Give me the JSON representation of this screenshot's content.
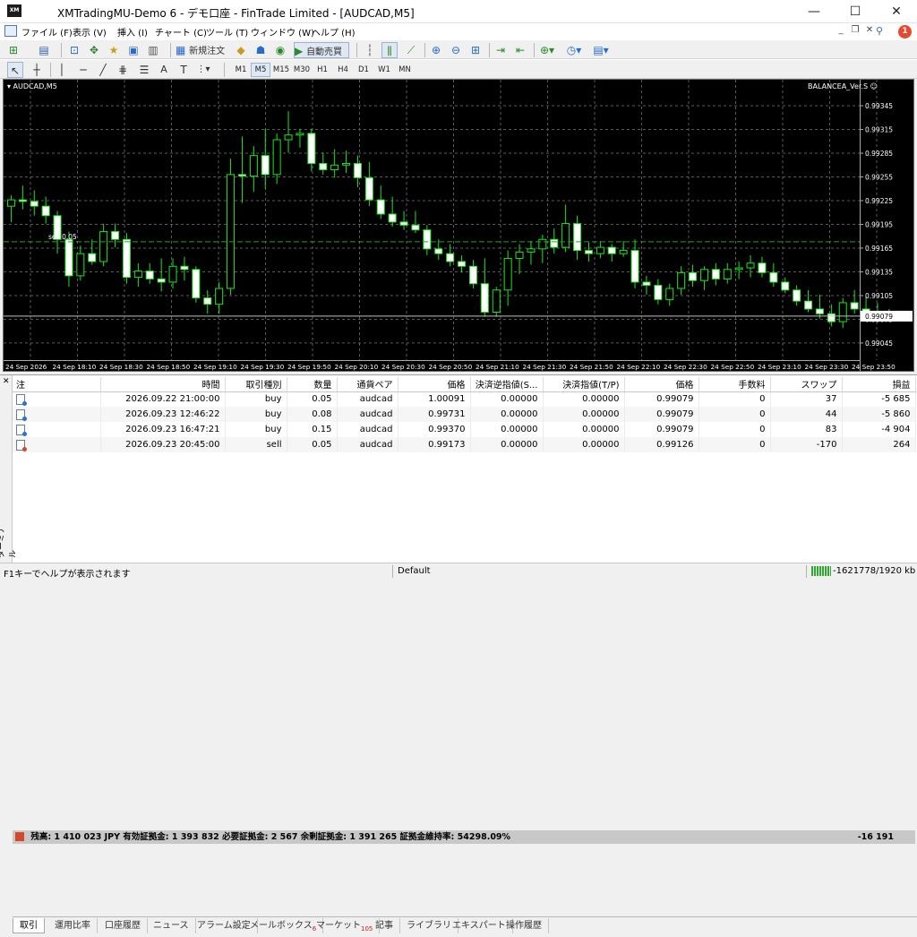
{
  "window": {
    "title": "XMTradingMU-Demo 6 - デモ口座 - FinTrade Limited - [AUDCAD,M5]",
    "minimize": "—",
    "maximize": "☐",
    "close": "✕"
  },
  "menu": {
    "items": [
      "ファイル (F)",
      "表示 (V)",
      "挿入 (I)",
      "チャート (C)",
      "ツール (T)",
      "ウィンドウ (W)",
      "ヘルプ (H)"
    ],
    "help_badge": "1"
  },
  "toolbar": {
    "new_order": "新規注文",
    "auto_trading": "自動売買"
  },
  "timeframes": [
    "M1",
    "M5",
    "M15",
    "M30",
    "H1",
    "H4",
    "D1",
    "W1",
    "MN"
  ],
  "active_timeframe": "M5",
  "chart": {
    "symbol_label": "▾ AUDCAD,M5",
    "ea_label": "BALANCEA_Ver.S ☺",
    "order_line_label": "sell 0.05",
    "current_price_label": "0.99079",
    "price_ticks": [
      "0.99345",
      "0.99315",
      "0.99285",
      "0.99255",
      "0.99225",
      "0.99195",
      "0.99165",
      "0.99135",
      "0.99105",
      "0.99075",
      "0.99045"
    ],
    "time_ticks": [
      "24 Sep 2026",
      "24 Sep 18:10",
      "24 Sep 18:30",
      "24 Sep 18:50",
      "24 Sep 19:10",
      "24 Sep 19:30",
      "24 Sep 19:50",
      "24 Sep 20:10",
      "24 Sep 20:30",
      "24 Sep 20:50",
      "24 Sep 21:10",
      "24 Sep 21:30",
      "24 Sep 21:50",
      "24 Sep 22:10",
      "24 Sep 22:30",
      "24 Sep 22:50",
      "24 Sep 23:10",
      "24 Sep 23:30",
      "24 Sep 23:50"
    ],
    "colors": {
      "background": "#000000",
      "grid": "#5a5a5a",
      "candle_bull_body": "#000000",
      "candle_bear_body": "#ffffff",
      "wick": "#19e619",
      "order_line": "#1fa51f",
      "bid_line": "#c0c0c0"
    },
    "price_range": [
      0.99037,
      0.99362
    ],
    "candles": [
      [
        0.99218,
        0.99232,
        0.99198,
        0.99226
      ],
      [
        0.99226,
        0.99244,
        0.99214,
        0.99224
      ],
      [
        0.99224,
        0.99238,
        0.99206,
        0.99218
      ],
      [
        0.99218,
        0.9923,
        0.99196,
        0.99206
      ],
      [
        0.99206,
        0.99212,
        0.99158,
        0.99176
      ],
      [
        0.99176,
        0.99186,
        0.99116,
        0.9913
      ],
      [
        0.9913,
        0.99168,
        0.99124,
        0.99158
      ],
      [
        0.99158,
        0.99176,
        0.99144,
        0.99148
      ],
      [
        0.99148,
        0.99196,
        0.99142,
        0.99186
      ],
      [
        0.99186,
        0.99196,
        0.99166,
        0.99176
      ],
      [
        0.99176,
        0.99184,
        0.9912,
        0.99128
      ],
      [
        0.99128,
        0.99146,
        0.99116,
        0.99136
      ],
      [
        0.99136,
        0.99146,
        0.9912,
        0.99126
      ],
      [
        0.99126,
        0.99152,
        0.9911,
        0.99122
      ],
      [
        0.99122,
        0.99152,
        0.99114,
        0.99142
      ],
      [
        0.99142,
        0.99154,
        0.99124,
        0.99138
      ],
      [
        0.99138,
        0.99142,
        0.99096,
        0.99102
      ],
      [
        0.99102,
        0.99112,
        0.99082,
        0.99094
      ],
      [
        0.99094,
        0.99122,
        0.99082,
        0.99114
      ],
      [
        0.99114,
        0.99278,
        0.99106,
        0.99258
      ],
      [
        0.99258,
        0.99306,
        0.99222,
        0.99256
      ],
      [
        0.99256,
        0.99294,
        0.99236,
        0.99282
      ],
      [
        0.99282,
        0.99316,
        0.9924,
        0.99258
      ],
      [
        0.99258,
        0.9931,
        0.99246,
        0.99302
      ],
      [
        0.99302,
        0.99338,
        0.99286,
        0.99308
      ],
      [
        0.99308,
        0.99316,
        0.99292,
        0.9931
      ],
      [
        0.9931,
        0.99316,
        0.99262,
        0.99272
      ],
      [
        0.99272,
        0.99286,
        0.99258,
        0.99264
      ],
      [
        0.99264,
        0.9929,
        0.99254,
        0.9927
      ],
      [
        0.9927,
        0.99288,
        0.9926,
        0.99272
      ],
      [
        0.99272,
        0.99282,
        0.99242,
        0.99254
      ],
      [
        0.99254,
        0.99274,
        0.99218,
        0.99226
      ],
      [
        0.99226,
        0.99244,
        0.99202,
        0.99208
      ],
      [
        0.99208,
        0.9923,
        0.99192,
        0.99198
      ],
      [
        0.99198,
        0.99212,
        0.99188,
        0.99194
      ],
      [
        0.99194,
        0.99212,
        0.99184,
        0.99188
      ],
      [
        0.99188,
        0.99194,
        0.99156,
        0.99164
      ],
      [
        0.99164,
        0.99176,
        0.9915,
        0.99158
      ],
      [
        0.99158,
        0.9917,
        0.99142,
        0.99148
      ],
      [
        0.99148,
        0.99156,
        0.99134,
        0.99142
      ],
      [
        0.99142,
        0.9915,
        0.99114,
        0.9912
      ],
      [
        0.9912,
        0.99152,
        0.99078,
        0.99084
      ],
      [
        0.99084,
        0.99116,
        0.99078,
        0.99112
      ],
      [
        0.99112,
        0.99162,
        0.99092,
        0.99152
      ],
      [
        0.99152,
        0.9917,
        0.99132,
        0.9916
      ],
      [
        0.9916,
        0.99174,
        0.99144,
        0.99164
      ],
      [
        0.99164,
        0.99182,
        0.99146,
        0.99176
      ],
      [
        0.99176,
        0.9919,
        0.99158,
        0.99166
      ],
      [
        0.99166,
        0.9922,
        0.9916,
        0.99196
      ],
      [
        0.99196,
        0.99206,
        0.9915,
        0.99162
      ],
      [
        0.99162,
        0.99172,
        0.99148,
        0.99158
      ],
      [
        0.99158,
        0.99174,
        0.99152,
        0.99166
      ],
      [
        0.99166,
        0.9917,
        0.99148,
        0.99158
      ],
      [
        0.99158,
        0.99174,
        0.99154,
        0.99162
      ],
      [
        0.99162,
        0.99176,
        0.99114,
        0.99122
      ],
      [
        0.99122,
        0.9913,
        0.99106,
        0.99118
      ],
      [
        0.99118,
        0.99126,
        0.99094,
        0.991
      ],
      [
        0.991,
        0.9912,
        0.99092,
        0.99114
      ],
      [
        0.99114,
        0.99142,
        0.99106,
        0.99134
      ],
      [
        0.99134,
        0.99144,
        0.99116,
        0.99124
      ],
      [
        0.99124,
        0.99142,
        0.99112,
        0.99138
      ],
      [
        0.99138,
        0.99146,
        0.99118,
        0.99126
      ],
      [
        0.99126,
        0.99146,
        0.9912,
        0.99138
      ],
      [
        0.99138,
        0.99148,
        0.99126,
        0.9914
      ],
      [
        0.9914,
        0.99156,
        0.99128,
        0.99146
      ],
      [
        0.99146,
        0.99154,
        0.99128,
        0.99134
      ],
      [
        0.99134,
        0.99146,
        0.99116,
        0.99122
      ],
      [
        0.99122,
        0.99128,
        0.99108,
        0.99112
      ],
      [
        0.99112,
        0.99118,
        0.99092,
        0.99098
      ],
      [
        0.99098,
        0.99112,
        0.99084,
        0.99088
      ],
      [
        0.99088,
        0.99106,
        0.99076,
        0.99082
      ],
      [
        0.99082,
        0.99094,
        0.99066,
        0.99072
      ],
      [
        0.99072,
        0.99102,
        0.99064,
        0.99096
      ],
      [
        0.99096,
        0.99112,
        0.99082,
        0.99088
      ],
      [
        0.99088,
        0.99104,
        0.99074,
        0.99082
      ],
      [
        0.99082,
        0.99096,
        0.99076,
        0.9908
      ],
      [
        0.9908,
        0.99088,
        0.99074,
        0.99079
      ]
    ]
  },
  "trades": {
    "headers": [
      "注",
      "時間",
      "取引種別",
      "数量",
      "通貨ペア",
      "価格",
      "決済逆指値(S...",
      "決済指値(T/P)",
      "価格",
      "手数料",
      "スワップ",
      "損益"
    ],
    "rows": [
      {
        "type": "buy",
        "cells": [
          "",
          "2026.09.22 21:00:00",
          "buy",
          "0.05",
          "audcad",
          "1.00091",
          "0.00000",
          "0.00000",
          "0.99079",
          "0",
          "37",
          "-5 685"
        ]
      },
      {
        "type": "buy",
        "cells": [
          "",
          "2026.09.23 12:46:22",
          "buy",
          "0.08",
          "audcad",
          "0.99731",
          "0.00000",
          "0.00000",
          "0.99079",
          "0",
          "44",
          "-5 860"
        ]
      },
      {
        "type": "buy",
        "cells": [
          "",
          "2026.09.23 16:47:21",
          "buy",
          "0.15",
          "audcad",
          "0.99370",
          "0.00000",
          "0.00000",
          "0.99079",
          "0",
          "83",
          "-4 904"
        ]
      },
      {
        "type": "sell",
        "cells": [
          "",
          "2026.09.23 20:45:00",
          "sell",
          "0.05",
          "audcad",
          "0.99173",
          "0.00000",
          "0.00000",
          "0.99126",
          "0",
          "-170",
          "264"
        ]
      }
    ],
    "summary": "残高: 1 410 023 JPY  有効証拠金: 1 393 832  必要証拠金: 2 567  余剰証拠金: 1 391 265  証拠金維持率: 54298.09%",
    "summary_profit": "-16 191"
  },
  "terminal": {
    "side_label": "ターミナル",
    "close": "✕"
  },
  "tabs": [
    {
      "label": "取引",
      "badge": ""
    },
    {
      "label": "運用比率",
      "badge": ""
    },
    {
      "label": "口座履歴",
      "badge": ""
    },
    {
      "label": "ニュース",
      "badge": ""
    },
    {
      "label": "アラーム設定",
      "badge": ""
    },
    {
      "label": "メールボックス",
      "badge": "6"
    },
    {
      "label": "マーケット",
      "badge": "105"
    },
    {
      "label": "記事",
      "badge": ""
    },
    {
      "label": "ライブラリ",
      "badge": ""
    },
    {
      "label": "エキスパート",
      "badge": ""
    },
    {
      "label": "操作履歴",
      "badge": ""
    }
  ],
  "status": {
    "help": "F1キーでヘルプが表示されます",
    "profile": "Default",
    "connection": "-1621778/1920 kb"
  }
}
